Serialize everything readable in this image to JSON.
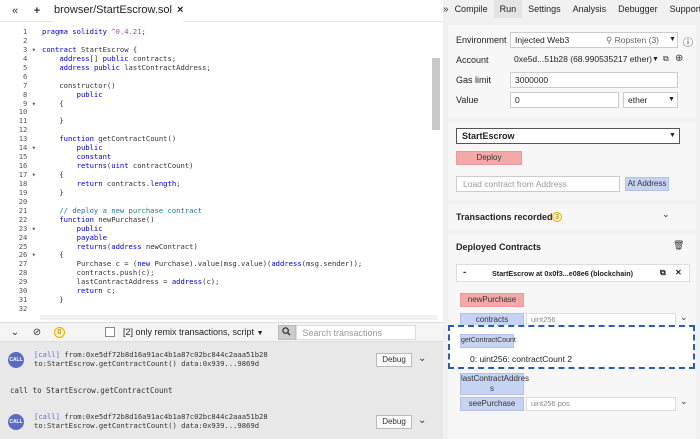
{
  "topbar": {
    "collapse_left": "«",
    "new_file": "+",
    "file_tab": "browser/StartEscrow.sol",
    "close": "×",
    "collapse_right": "»"
  },
  "editor": {
    "line_numbers": [
      "1",
      "2",
      "3",
      "4",
      "5",
      "6",
      "7",
      "8",
      "9",
      "10",
      "11",
      "12",
      "13",
      "14",
      "15",
      "16",
      "17",
      "18",
      "19",
      "20",
      "21",
      "22",
      "23",
      "24",
      "25",
      "26",
      "27",
      "28",
      "29",
      "30",
      "31",
      "32"
    ],
    "fold_lines": [
      3,
      9,
      14,
      17,
      23,
      26
    ]
  },
  "terminal_bar": {
    "collapse": "⌄",
    "clear": "⊘",
    "count": "0",
    "filter_label": "[2] only remix transactions, script",
    "filter_caret": "▼",
    "search_placeholder": "Search transactions"
  },
  "terminal": {
    "entries": [
      {
        "badge": "CALL",
        "line1_tag": "[call]",
        "line1": " from:0xe5df72b8d16a91ac4b1a87c02bc844c2aaa51b28",
        "line2": "to:StartEscrow.getContractCount() data:0x939...9869d",
        "debug": "Debug"
      },
      {
        "badge": "CALL",
        "line1_tag": "[call]",
        "line1": " from:0xe5df72b8d16a91ac4b1a87c02bc844c2aaa51b28",
        "line2": "to:StartEscrow.getContractCount() data:0x939...9869d",
        "debug": "Debug"
      }
    ],
    "plain": "call to StartEscrow.getContractCount"
  },
  "right_tabs": [
    "Compile",
    "Run",
    "Settings",
    "Analysis",
    "Debugger",
    "Support"
  ],
  "right_active": "Run",
  "env": {
    "environment_label": "Environment",
    "environment_value": "Injected Web3",
    "network": "⚲ Ropsten (3)",
    "account_label": "Account",
    "account_value": "0xe5d...51b28 (68.990535217 ether)",
    "gas_label": "Gas limit",
    "gas_value": "3000000",
    "value_label": "Value",
    "value_value": "0",
    "unit": "ether"
  },
  "contract": {
    "selected": "StartEscrow",
    "deploy": "Deploy",
    "load_placeholder": "Load contract from Address",
    "at_address": "At Address"
  },
  "transactions": {
    "title": "Transactions recorded:",
    "count": "3"
  },
  "deployed": {
    "title": "Deployed Contracts",
    "instance": "StartEscrow at 0x0f3...e08e6 (blockchain)",
    "functions": [
      {
        "name": "newPurchase",
        "param": ""
      },
      {
        "name": "contracts",
        "param": "uint256"
      },
      {
        "name": "getContractCount",
        "param": ""
      },
      {
        "name": "lastContractAddres s",
        "param": ""
      },
      {
        "name": "seePurchase",
        "param": "uint256 pos"
      }
    ],
    "result": "0: uint256: contractCount 2"
  },
  "colors": {
    "deploy": "#f4a9a9",
    "call_btn": "#c7d3f2",
    "highlight": "#2a5db0",
    "badge": "#5c6bc0"
  }
}
